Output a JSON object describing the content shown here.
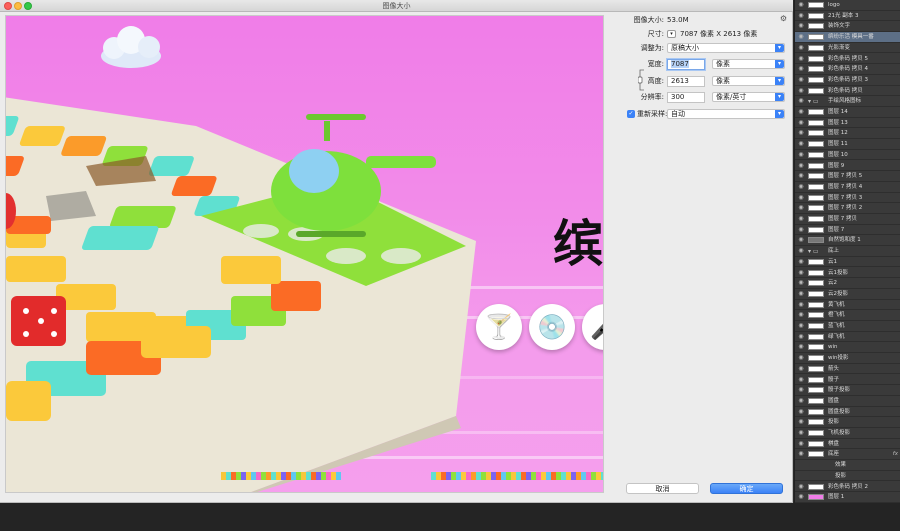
{
  "dialog": {
    "title": "图像大小"
  },
  "info": {
    "image_size_label": "图像大小:",
    "image_size_value": "53.0M",
    "dimensions_label": "尺寸:",
    "dimensions_value": "7087 像素  X  2613 像素",
    "fit_to_label": "调整为:",
    "fit_to_value": "原稿大小",
    "width_label": "宽度:",
    "width_value": "7087",
    "width_unit": "像素",
    "height_label": "高度:",
    "height_value": "2613",
    "height_unit": "像素",
    "resolution_label": "分辨率:",
    "resolution_value": "300",
    "resolution_unit": "像素/英寸",
    "resample_label": "重新采样:",
    "resample_value": "自动",
    "cancel_label": "取消",
    "ok_label": "确定"
  },
  "preview": {
    "big_char": "缤",
    "icons": [
      "cocktail-icon",
      "music-disc-icon",
      "microphone-icon"
    ]
  },
  "layers": [
    {
      "name": "logo",
      "type": "layer"
    },
    {
      "name": "21光 副本 3",
      "type": "layer"
    },
    {
      "name": "装饰文字",
      "type": "layer"
    },
    {
      "name": "缤纷乐活 模具一番",
      "type": "layer",
      "selected": true
    },
    {
      "name": "光影渐变",
      "type": "layer"
    },
    {
      "name": "彩色条码 拷贝 5",
      "type": "layer"
    },
    {
      "name": "彩色条码 拷贝 4",
      "type": "layer"
    },
    {
      "name": "彩色条码 拷贝 3",
      "type": "layer"
    },
    {
      "name": "彩色条码 拷贝",
      "type": "layer"
    },
    {
      "name": "手绘风格图标",
      "type": "group"
    },
    {
      "name": "图层 14",
      "type": "layer"
    },
    {
      "name": "图层 13",
      "type": "layer"
    },
    {
      "name": "图层 12",
      "type": "layer"
    },
    {
      "name": "图层 11",
      "type": "layer"
    },
    {
      "name": "图层 10",
      "type": "layer"
    },
    {
      "name": "图层 9",
      "type": "layer"
    },
    {
      "name": "图层 7 拷贝 5",
      "type": "layer"
    },
    {
      "name": "图层 7 拷贝 4",
      "type": "layer"
    },
    {
      "name": "图层 7 拷贝 3",
      "type": "layer"
    },
    {
      "name": "图层 7 拷贝 2",
      "type": "layer"
    },
    {
      "name": "图层 7 拷贝",
      "type": "layer"
    },
    {
      "name": "图层 7",
      "type": "layer"
    },
    {
      "name": "自然饱和度 1",
      "type": "adjust"
    },
    {
      "name": "底上",
      "type": "group"
    },
    {
      "name": "云1",
      "type": "layer"
    },
    {
      "name": "云1投影",
      "type": "layer"
    },
    {
      "name": "云2",
      "type": "layer"
    },
    {
      "name": "云2投影",
      "type": "layer"
    },
    {
      "name": "黄飞机",
      "type": "layer"
    },
    {
      "name": "橙飞机",
      "type": "layer"
    },
    {
      "name": "蓝飞机",
      "type": "layer"
    },
    {
      "name": "绿飞机",
      "type": "layer"
    },
    {
      "name": "win",
      "type": "layer"
    },
    {
      "name": "win投影",
      "type": "layer"
    },
    {
      "name": "箭头",
      "type": "layer"
    },
    {
      "name": "骰子",
      "type": "layer"
    },
    {
      "name": "骰子投影",
      "type": "layer"
    },
    {
      "name": "圆盘",
      "type": "layer"
    },
    {
      "name": "圆盘投影",
      "type": "layer"
    },
    {
      "name": "投影",
      "type": "layer"
    },
    {
      "name": "飞机投影",
      "type": "layer"
    },
    {
      "name": "棋盘",
      "type": "layer"
    },
    {
      "name": "底座",
      "type": "layer",
      "fx": "fx"
    },
    {
      "name": "效果",
      "type": "effect"
    },
    {
      "name": "投影",
      "type": "effect"
    },
    {
      "name": "彩色条码 拷贝 2",
      "type": "layer"
    },
    {
      "name": "图层 1",
      "type": "layer",
      "pink": true
    }
  ],
  "colors": {
    "accent": "#3b82f7",
    "preview_bg": "#f07de8",
    "panel_bg": "#3a3a3a",
    "selected_layer": "#5d6f86"
  }
}
